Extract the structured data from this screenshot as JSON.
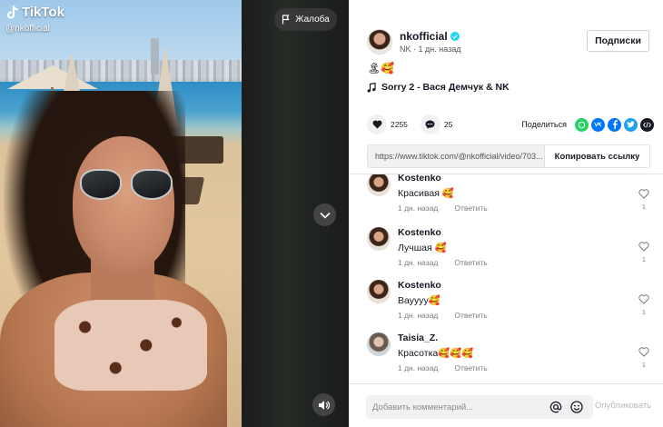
{
  "video": {
    "logo_text": "TikTok",
    "username": "@nkofficial",
    "report_label": "Жалоба"
  },
  "author": {
    "name": "nkofficial",
    "display_name": "NK",
    "time": "1 дн. назад",
    "follow_label": "Подписки",
    "caption": "🏝🥰",
    "music": "Sorry 2 - Вася Демчук & NK"
  },
  "stats": {
    "likes": "2255",
    "comments": "25",
    "share_label": "Поделиться"
  },
  "share": {
    "link": "https://www.tiktok.com/@nkofficial/video/703...",
    "copy_label": "Копировать ссылку"
  },
  "comments": [
    {
      "name": "Kostenko",
      "text": "Красивая 🥰",
      "time": "1 дн. назад",
      "reply": "Ответить",
      "likes": "1"
    },
    {
      "name": "Kostenko",
      "text": "Лучшая 🥰",
      "time": "1 дн. назад",
      "reply": "Ответить",
      "likes": "1"
    },
    {
      "name": "Kostenko",
      "text": "Вауууу🥰",
      "time": "1 дн. назад",
      "reply": "Ответить",
      "likes": "1"
    },
    {
      "name": "Taisia_Z.",
      "text": "Красотка🥰🥰🥰",
      "time": "1 дн. назад",
      "reply": "Ответить",
      "likes": "1"
    }
  ],
  "composer": {
    "placeholder": "Добавить комментарий...",
    "post_label": "Опубликовать"
  },
  "colors": {
    "verified": "#20d5ec",
    "whatsapp": "#25d366",
    "vk": "#0077ff",
    "facebook": "#0075fa",
    "twitter": "#1da1f2",
    "embed": "#161823"
  }
}
